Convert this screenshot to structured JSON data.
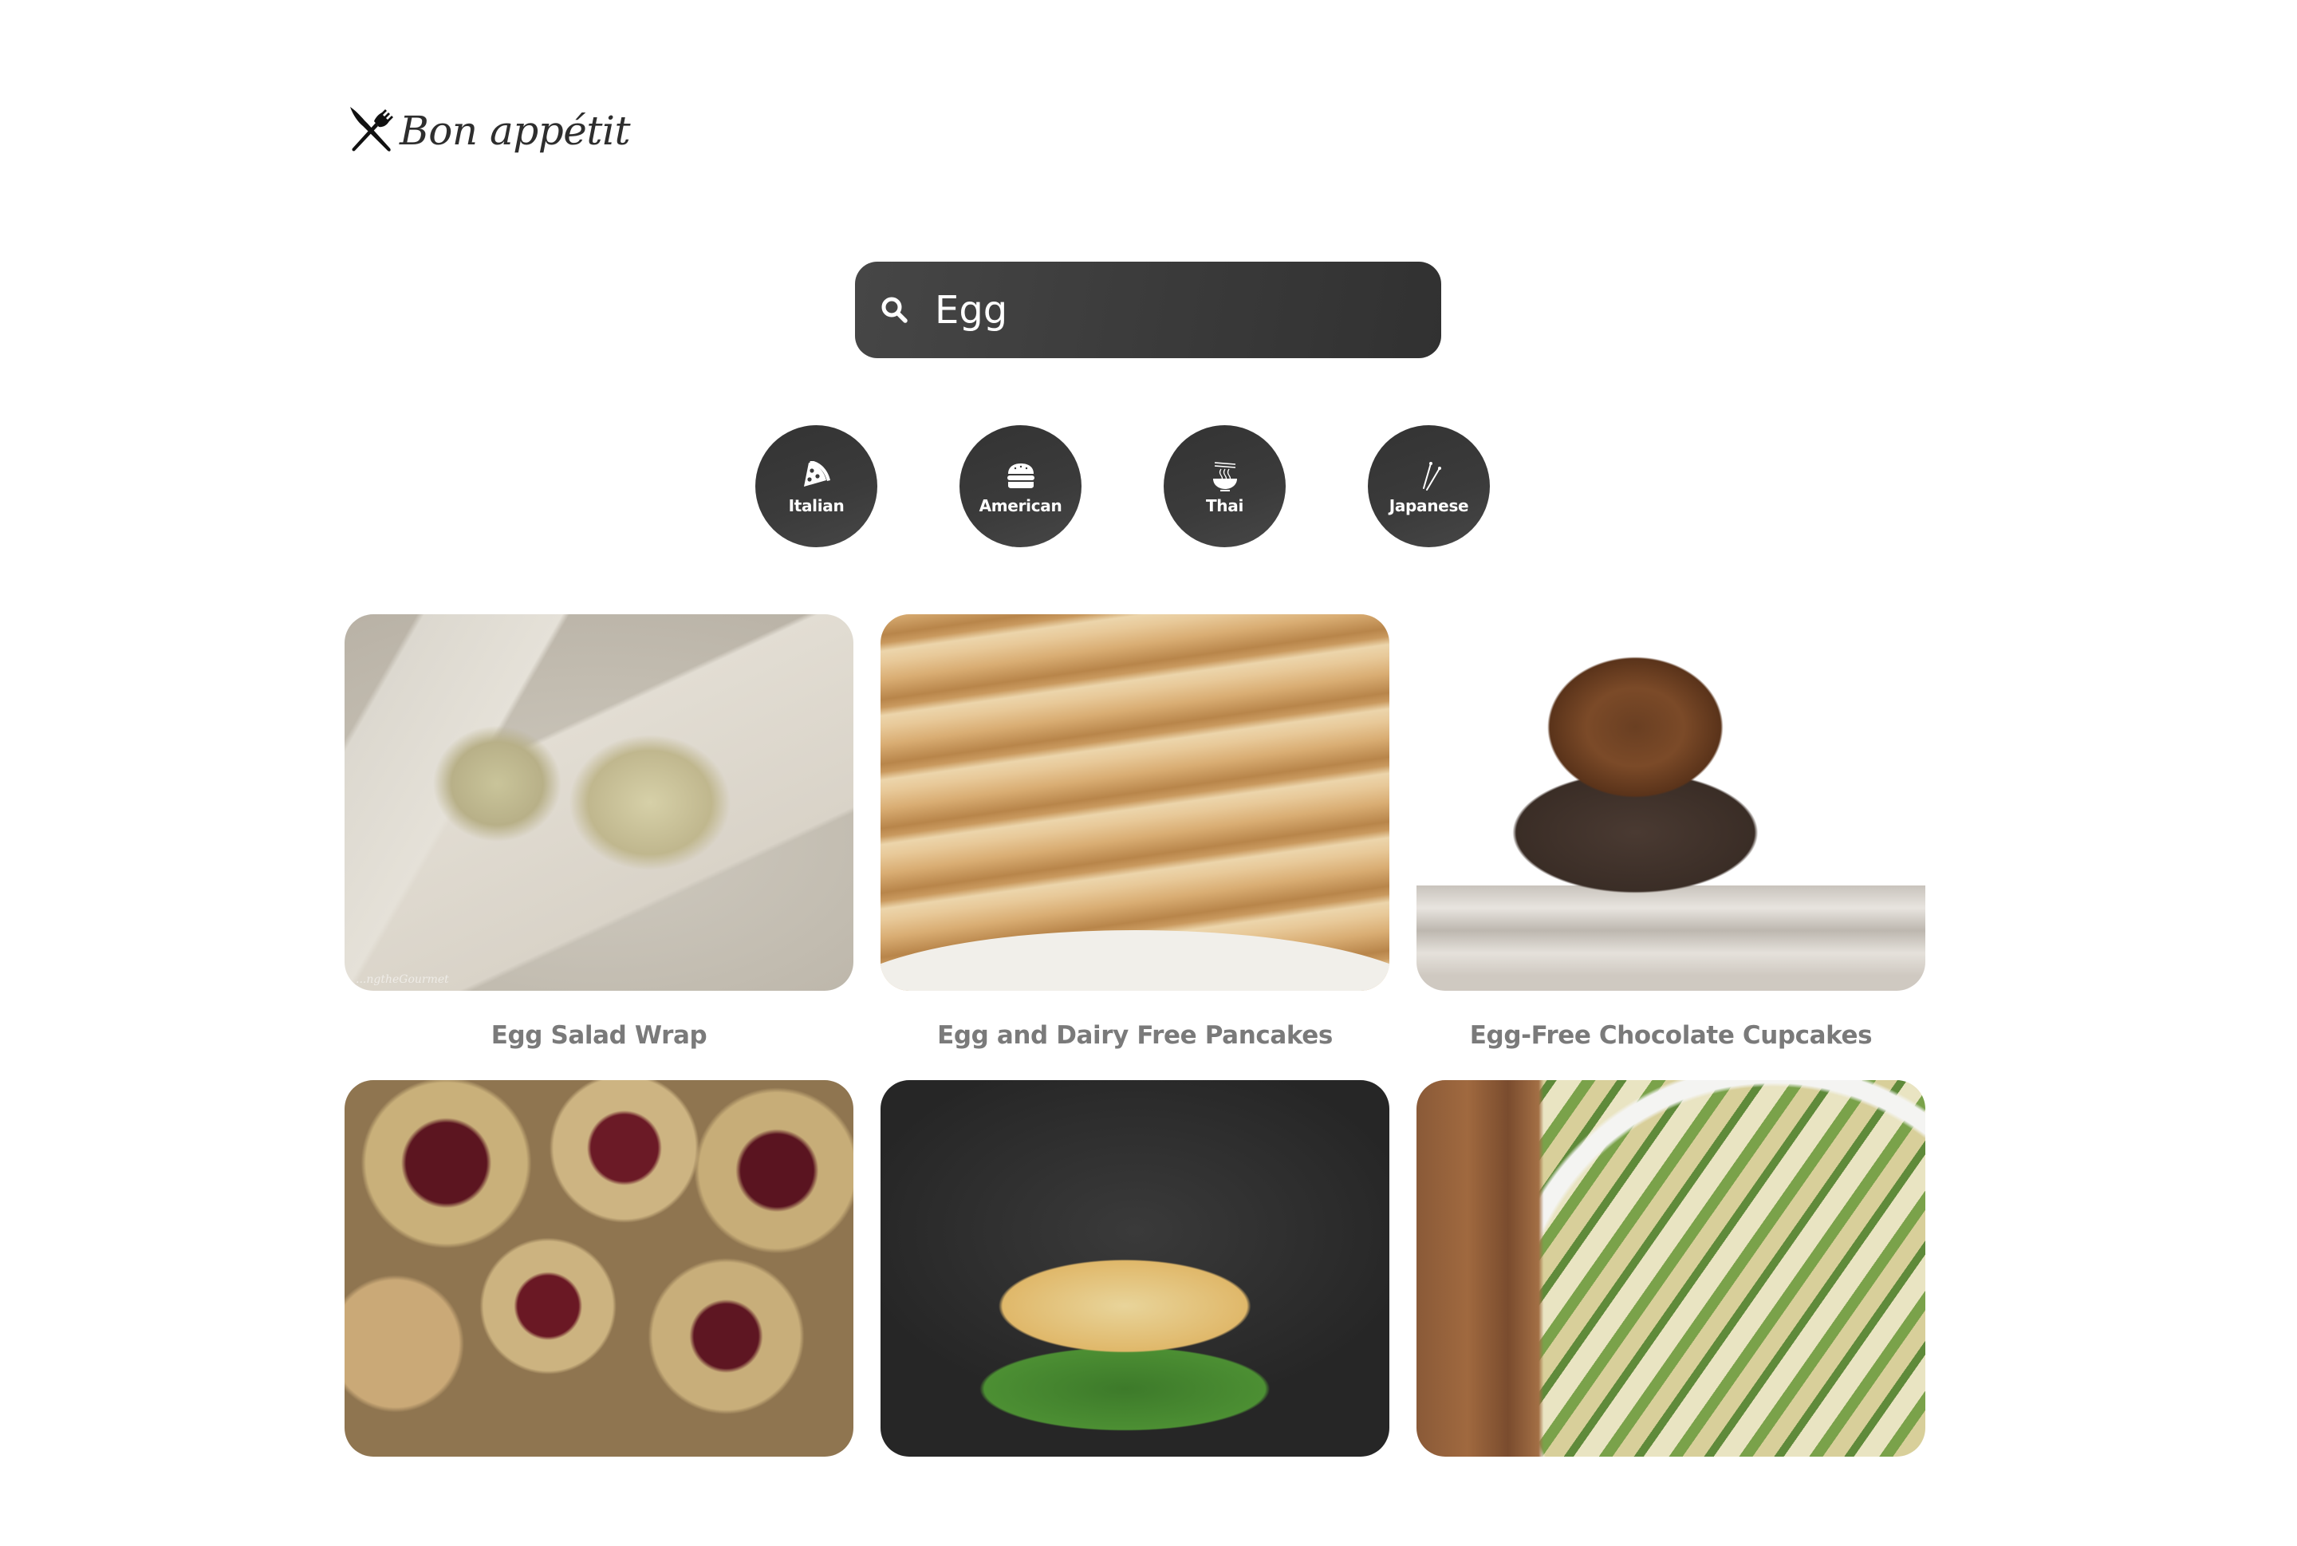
{
  "brand": {
    "name": "Bon appétit",
    "icon": "fork-knife-icon"
  },
  "search": {
    "icon": "search-icon",
    "value": "Egg",
    "placeholder": ""
  },
  "categories": [
    {
      "label": "Italian",
      "icon": "pizza-slice-icon"
    },
    {
      "label": "American",
      "icon": "burger-icon"
    },
    {
      "label": "Thai",
      "icon": "noodle-bowl-icon"
    },
    {
      "label": "Japanese",
      "icon": "chopsticks-icon"
    }
  ],
  "recipes": [
    {
      "title": "Egg Salad Wrap",
      "image": "egg-salad-wrap-photo",
      "watermark": "...ngtheGourmet"
    },
    {
      "title": "Egg and Dairy Free Pancakes",
      "image": "pancakes-photo"
    },
    {
      "title": "Egg-Free Chocolate Cupcakes",
      "image": "chocolate-cupcake-photo"
    },
    {
      "title": "",
      "image": "jam-thumbprint-cookies-photo"
    },
    {
      "title": "",
      "image": "egg-sandwich-photo"
    },
    {
      "title": "",
      "image": "asparagus-frittata-photo"
    }
  ],
  "colors": {
    "dark_surface": "#3a3a3a",
    "title_text": "#7a7a7a",
    "logo_text": "#2e2e2e",
    "background": "#ffffff"
  }
}
